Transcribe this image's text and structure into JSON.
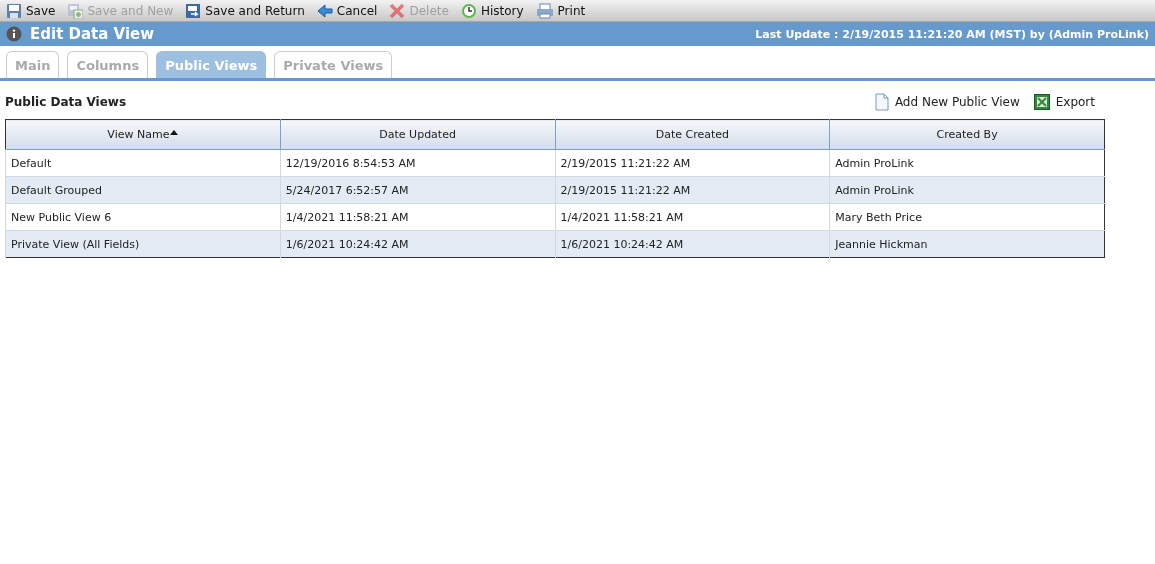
{
  "toolbar": [
    {
      "label": "Save",
      "kind": "save",
      "disabled": false
    },
    {
      "label": "Save and New",
      "kind": "save-new",
      "disabled": true
    },
    {
      "label": "Save and Return",
      "kind": "save-return",
      "disabled": false
    },
    {
      "label": "Cancel",
      "kind": "cancel",
      "disabled": false
    },
    {
      "label": "Delete",
      "kind": "delete",
      "disabled": true
    },
    {
      "label": "History",
      "kind": "history",
      "disabled": false
    },
    {
      "label": "Print",
      "kind": "print",
      "disabled": false
    }
  ],
  "header": {
    "title": "Edit Data View",
    "last_update": "Last Update : 2/19/2015 11:21:20 AM (MST) by (Admin ProLink)"
  },
  "tabs": [
    {
      "label": "Main",
      "selected": false
    },
    {
      "label": "Columns",
      "selected": false
    },
    {
      "label": "Public Views",
      "selected": true
    },
    {
      "label": "Private Views",
      "selected": false
    }
  ],
  "section": {
    "title": "Public Data Views",
    "actions": [
      {
        "label": "Add New Public View",
        "kind": "page"
      },
      {
        "label": "Export",
        "kind": "excel"
      }
    ]
  },
  "table": {
    "columns": [
      {
        "label": "View Name",
        "sorted": true
      },
      {
        "label": "Date Updated",
        "sorted": false
      },
      {
        "label": "Date Created",
        "sorted": false
      },
      {
        "label": "Created By",
        "sorted": false
      }
    ],
    "rows": [
      [
        "Default",
        "12/19/2016 8:54:53 AM",
        "2/19/2015 11:21:22 AM",
        "Admin ProLink"
      ],
      [
        "Default Grouped",
        "5/24/2017 6:52:57 AM",
        "2/19/2015 11:21:22 AM",
        "Admin ProLink"
      ],
      [
        "New Public View 6",
        "1/4/2021 11:58:21 AM",
        "1/4/2021 11:58:21 AM",
        "Mary Beth Price"
      ],
      [
        "Private View (All Fields)",
        "1/6/2021 10:24:42 AM",
        "1/6/2021 10:24:42 AM",
        "Jeannie Hickman"
      ]
    ]
  }
}
